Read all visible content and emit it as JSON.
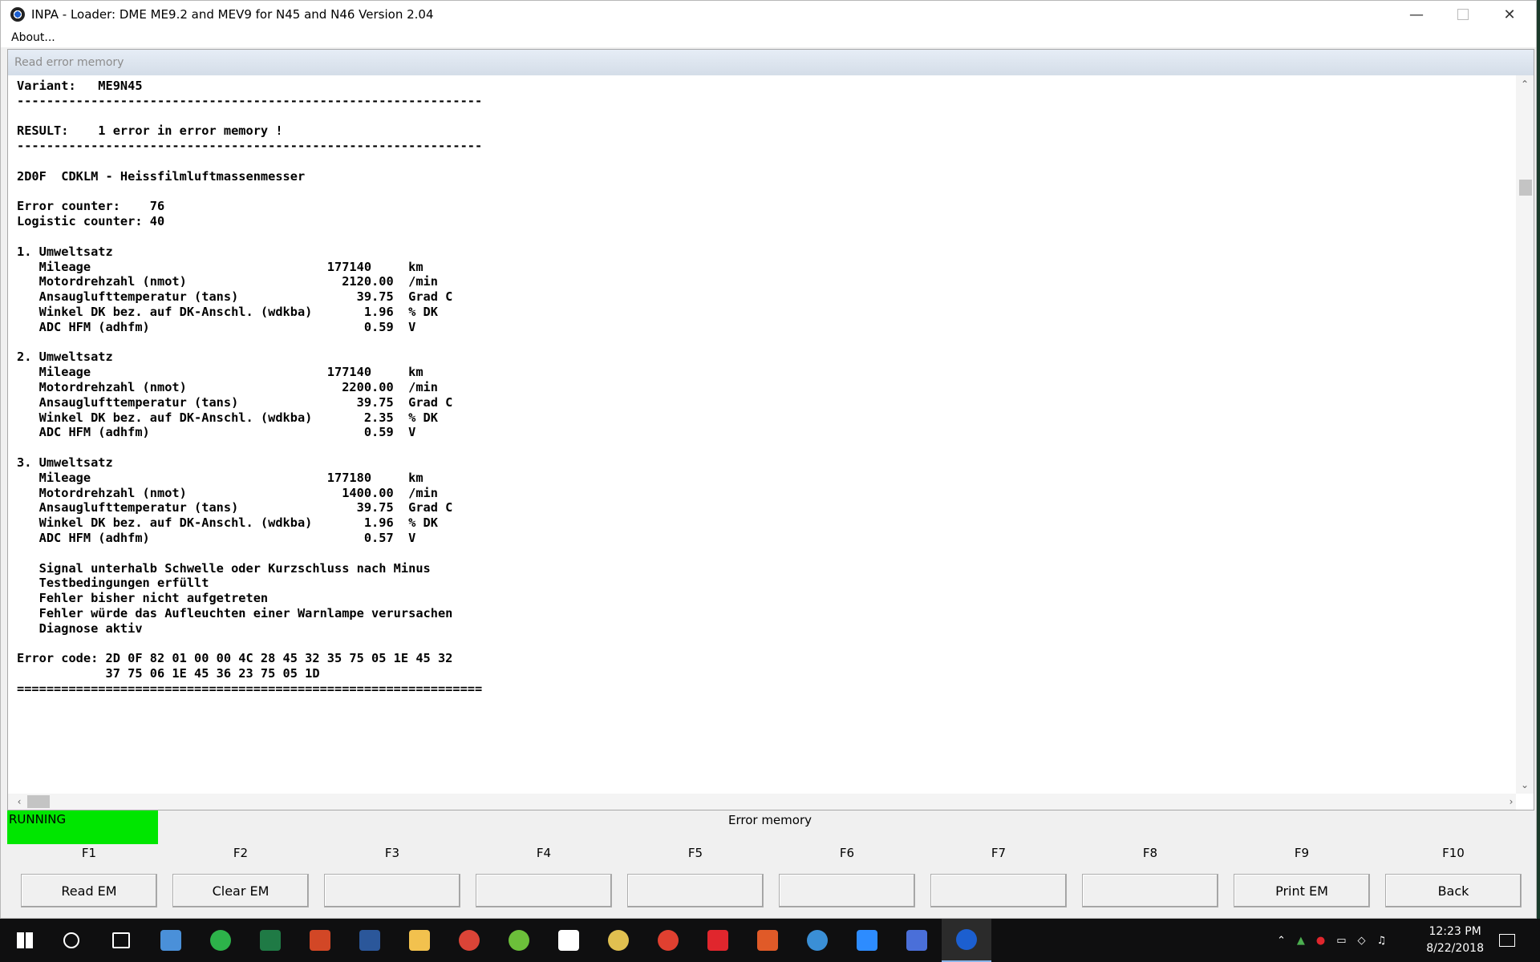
{
  "window": {
    "title": "INPA - Loader:  DME ME9.2 and MEV9 for N45 and N46 Version 2.04",
    "menu": [
      "About..."
    ]
  },
  "panel": {
    "header": "Read error memory"
  },
  "log_lines": [
    "Variant:   ME9N45",
    "---------------------------------------------------------------",
    "",
    "RESULT:    1 error in error memory !",
    "---------------------------------------------------------------",
    "",
    "2D0F  CDKLM - Heissfilmluftmassenmesser",
    "",
    "Error counter:    76",
    "Logistic counter: 40",
    "",
    "1. Umweltsatz",
    "   Mileage                                177140     km",
    "   Motordrehzahl (nmot)                     2120.00  /min",
    "   Ansauglufttemperatur (tans)                39.75  Grad C",
    "   Winkel DK bez. auf DK-Anschl. (wdkba)       1.96  % DK",
    "   ADC HFM (adhfm)                             0.59  V",
    "",
    "2. Umweltsatz",
    "   Mileage                                177140     km",
    "   Motordrehzahl (nmot)                     2200.00  /min",
    "   Ansauglufttemperatur (tans)                39.75  Grad C",
    "   Winkel DK bez. auf DK-Anschl. (wdkba)       2.35  % DK",
    "   ADC HFM (adhfm)                             0.59  V",
    "",
    "3. Umweltsatz",
    "   Mileage                                177180     km",
    "   Motordrehzahl (nmot)                     1400.00  /min",
    "   Ansauglufttemperatur (tans)                39.75  Grad C",
    "   Winkel DK bez. auf DK-Anschl. (wdkba)       1.96  % DK",
    "   ADC HFM (adhfm)                             0.57  V",
    "",
    "   Signal unterhalb Schwelle oder Kurzschluss nach Minus",
    "   Testbedingungen erfüllt",
    "   Fehler bisher nicht aufgetreten",
    "   Fehler würde das Aufleuchten einer Warnlampe verursachen",
    "   Diagnose aktiv",
    "",
    "Error code: 2D 0F 82 01 00 00 4C 28 45 32 35 75 05 1E 45 32",
    "            37 75 06 1E 45 36 23 75 05 1D",
    "==============================================================="
  ],
  "status": {
    "state": "RUNNING",
    "state_color": "#00e600",
    "title": "Error memory"
  },
  "fkeys": [
    {
      "key": "F1",
      "label": "Read EM"
    },
    {
      "key": "F2",
      "label": "Clear EM"
    },
    {
      "key": "F3",
      "label": ""
    },
    {
      "key": "F4",
      "label": ""
    },
    {
      "key": "F5",
      "label": ""
    },
    {
      "key": "F6",
      "label": ""
    },
    {
      "key": "F7",
      "label": ""
    },
    {
      "key": "F8",
      "label": ""
    },
    {
      "key": "F9",
      "label": "Print EM"
    },
    {
      "key": "F10",
      "label": "Back"
    }
  ],
  "taskbar": {
    "apps": [
      {
        "name": "start-icon",
        "color": "#ffffff"
      },
      {
        "name": "cortana-search-icon",
        "color": "#ffffff"
      },
      {
        "name": "task-view-icon",
        "color": "#ffffff"
      },
      {
        "name": "computer-icon",
        "color": "#4a90d9"
      },
      {
        "name": "green-app-icon",
        "color": "#2db34a"
      },
      {
        "name": "excel-icon",
        "color": "#1f7a45"
      },
      {
        "name": "powerpoint-icon",
        "color": "#d24726"
      },
      {
        "name": "word-icon",
        "color": "#2b579a"
      },
      {
        "name": "file-explorer-icon",
        "color": "#f2c14e"
      },
      {
        "name": "chrome-icon",
        "color": "#db4437"
      },
      {
        "name": "utorrent-icon",
        "color": "#6cbf3a"
      },
      {
        "name": "fox-app-icon",
        "color": "#ffffff"
      },
      {
        "name": "disc-app-icon",
        "color": "#e0c050"
      },
      {
        "name": "red-circle-app-icon",
        "color": "#e04030"
      },
      {
        "name": "acrobat-icon",
        "color": "#e0262d"
      },
      {
        "name": "ccleaner-icon",
        "color": "#e05a28"
      },
      {
        "name": "blue-circle-app-icon",
        "color": "#3a8fd6"
      },
      {
        "name": "zoom-icon",
        "color": "#2d8cff"
      },
      {
        "name": "network-app-icon",
        "color": "#4a6fd9"
      },
      {
        "name": "bmw-inpa-icon",
        "color": "#1c5fd0"
      }
    ],
    "time": "12:23 PM",
    "date": "8/22/2018"
  }
}
